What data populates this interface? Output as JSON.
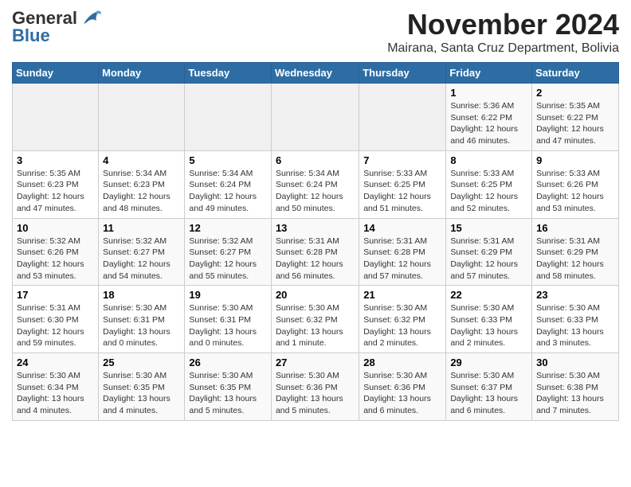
{
  "app": {
    "name": "GeneralBlue"
  },
  "title": "November 2024",
  "subtitle": "Mairana, Santa Cruz Department, Bolivia",
  "days_of_week": [
    "Sunday",
    "Monday",
    "Tuesday",
    "Wednesday",
    "Thursday",
    "Friday",
    "Saturday"
  ],
  "weeks": [
    [
      {
        "day": "",
        "info": ""
      },
      {
        "day": "",
        "info": ""
      },
      {
        "day": "",
        "info": ""
      },
      {
        "day": "",
        "info": ""
      },
      {
        "day": "",
        "info": ""
      },
      {
        "day": "1",
        "info": "Sunrise: 5:36 AM\nSunset: 6:22 PM\nDaylight: 12 hours and 46 minutes."
      },
      {
        "day": "2",
        "info": "Sunrise: 5:35 AM\nSunset: 6:22 PM\nDaylight: 12 hours and 47 minutes."
      }
    ],
    [
      {
        "day": "3",
        "info": "Sunrise: 5:35 AM\nSunset: 6:23 PM\nDaylight: 12 hours and 47 minutes."
      },
      {
        "day": "4",
        "info": "Sunrise: 5:34 AM\nSunset: 6:23 PM\nDaylight: 12 hours and 48 minutes."
      },
      {
        "day": "5",
        "info": "Sunrise: 5:34 AM\nSunset: 6:24 PM\nDaylight: 12 hours and 49 minutes."
      },
      {
        "day": "6",
        "info": "Sunrise: 5:34 AM\nSunset: 6:24 PM\nDaylight: 12 hours and 50 minutes."
      },
      {
        "day": "7",
        "info": "Sunrise: 5:33 AM\nSunset: 6:25 PM\nDaylight: 12 hours and 51 minutes."
      },
      {
        "day": "8",
        "info": "Sunrise: 5:33 AM\nSunset: 6:25 PM\nDaylight: 12 hours and 52 minutes."
      },
      {
        "day": "9",
        "info": "Sunrise: 5:33 AM\nSunset: 6:26 PM\nDaylight: 12 hours and 53 minutes."
      }
    ],
    [
      {
        "day": "10",
        "info": "Sunrise: 5:32 AM\nSunset: 6:26 PM\nDaylight: 12 hours and 53 minutes."
      },
      {
        "day": "11",
        "info": "Sunrise: 5:32 AM\nSunset: 6:27 PM\nDaylight: 12 hours and 54 minutes."
      },
      {
        "day": "12",
        "info": "Sunrise: 5:32 AM\nSunset: 6:27 PM\nDaylight: 12 hours and 55 minutes."
      },
      {
        "day": "13",
        "info": "Sunrise: 5:31 AM\nSunset: 6:28 PM\nDaylight: 12 hours and 56 minutes."
      },
      {
        "day": "14",
        "info": "Sunrise: 5:31 AM\nSunset: 6:28 PM\nDaylight: 12 hours and 57 minutes."
      },
      {
        "day": "15",
        "info": "Sunrise: 5:31 AM\nSunset: 6:29 PM\nDaylight: 12 hours and 57 minutes."
      },
      {
        "day": "16",
        "info": "Sunrise: 5:31 AM\nSunset: 6:29 PM\nDaylight: 12 hours and 58 minutes."
      }
    ],
    [
      {
        "day": "17",
        "info": "Sunrise: 5:31 AM\nSunset: 6:30 PM\nDaylight: 12 hours and 59 minutes."
      },
      {
        "day": "18",
        "info": "Sunrise: 5:30 AM\nSunset: 6:31 PM\nDaylight: 13 hours and 0 minutes."
      },
      {
        "day": "19",
        "info": "Sunrise: 5:30 AM\nSunset: 6:31 PM\nDaylight: 13 hours and 0 minutes."
      },
      {
        "day": "20",
        "info": "Sunrise: 5:30 AM\nSunset: 6:32 PM\nDaylight: 13 hours and 1 minute."
      },
      {
        "day": "21",
        "info": "Sunrise: 5:30 AM\nSunset: 6:32 PM\nDaylight: 13 hours and 2 minutes."
      },
      {
        "day": "22",
        "info": "Sunrise: 5:30 AM\nSunset: 6:33 PM\nDaylight: 13 hours and 2 minutes."
      },
      {
        "day": "23",
        "info": "Sunrise: 5:30 AM\nSunset: 6:33 PM\nDaylight: 13 hours and 3 minutes."
      }
    ],
    [
      {
        "day": "24",
        "info": "Sunrise: 5:30 AM\nSunset: 6:34 PM\nDaylight: 13 hours and 4 minutes."
      },
      {
        "day": "25",
        "info": "Sunrise: 5:30 AM\nSunset: 6:35 PM\nDaylight: 13 hours and 4 minutes."
      },
      {
        "day": "26",
        "info": "Sunrise: 5:30 AM\nSunset: 6:35 PM\nDaylight: 13 hours and 5 minutes."
      },
      {
        "day": "27",
        "info": "Sunrise: 5:30 AM\nSunset: 6:36 PM\nDaylight: 13 hours and 5 minutes."
      },
      {
        "day": "28",
        "info": "Sunrise: 5:30 AM\nSunset: 6:36 PM\nDaylight: 13 hours and 6 minutes."
      },
      {
        "day": "29",
        "info": "Sunrise: 5:30 AM\nSunset: 6:37 PM\nDaylight: 13 hours and 6 minutes."
      },
      {
        "day": "30",
        "info": "Sunrise: 5:30 AM\nSunset: 6:38 PM\nDaylight: 13 hours and 7 minutes."
      }
    ]
  ]
}
